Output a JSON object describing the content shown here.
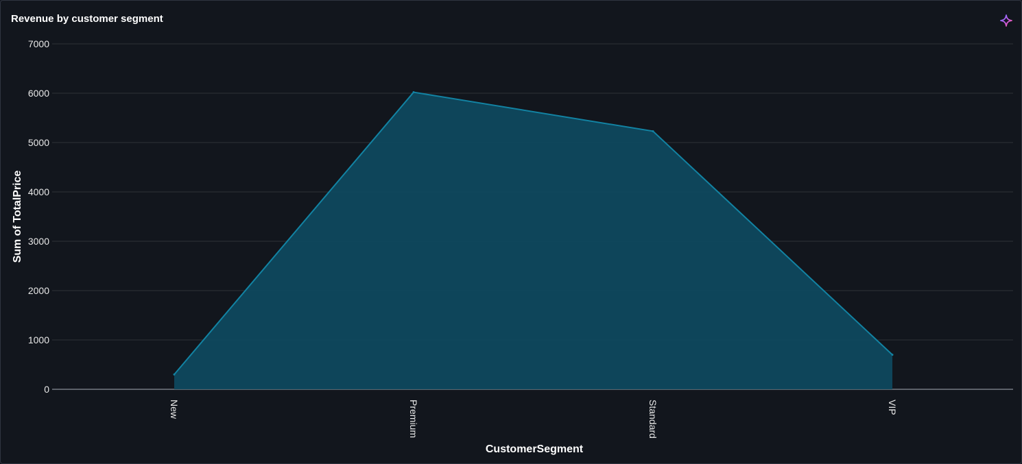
{
  "visual": {
    "title": "Revenue by customer segment",
    "copilot_icon": "sparkle-icon"
  },
  "colors": {
    "background": "#12161d",
    "grid": "#2e3238",
    "area_fill": "#0e4a5f",
    "line": "#1283a3",
    "baseline": "#8a9099",
    "text": "#e8e8e8"
  },
  "chart_data": {
    "type": "area",
    "title": "Revenue by customer segment",
    "xlabel": "CustomerSegment",
    "ylabel": "Sum of TotalPrice",
    "categories": [
      "New",
      "Premium",
      "Standard",
      "VIP"
    ],
    "series": [
      {
        "values": [
          300,
          6020,
          5230,
          700
        ]
      }
    ],
    "ylim": [
      0,
      7000
    ],
    "yticks": [
      0,
      1000,
      2000,
      3000,
      4000,
      5000,
      6000,
      7000
    ],
    "grid": true,
    "legend": "none"
  }
}
